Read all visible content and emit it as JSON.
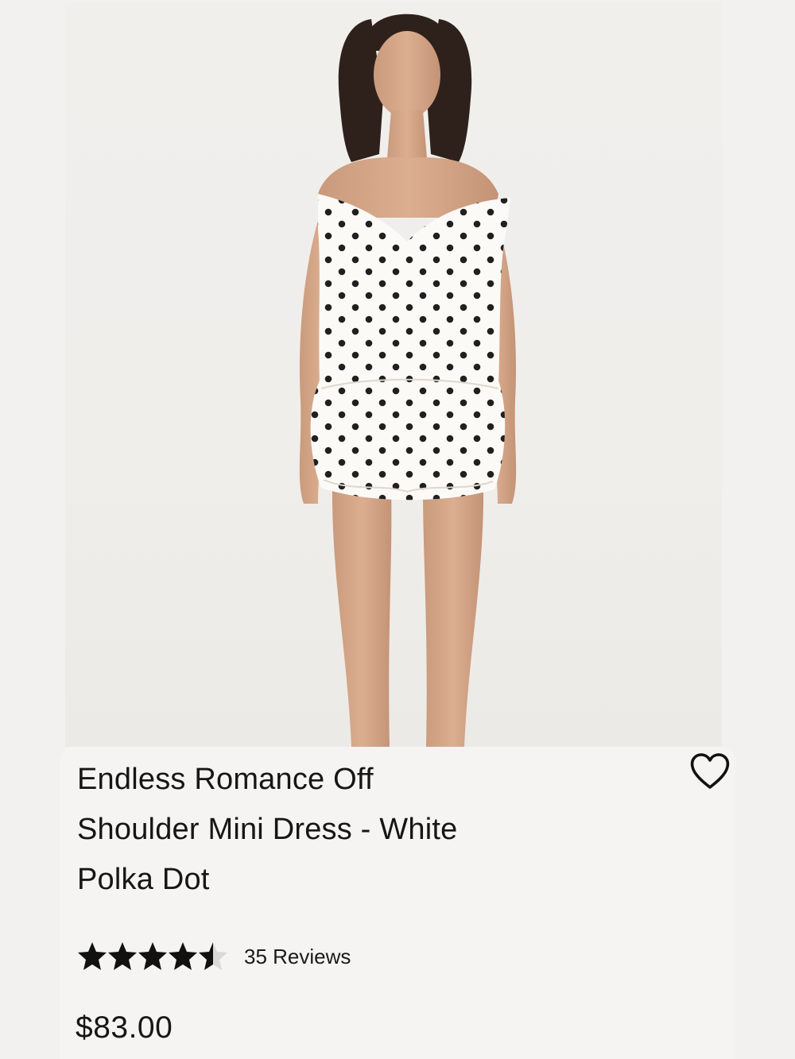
{
  "product": {
    "image_alt": "Model wearing white off shoulder mini dress with black polka dots",
    "title_lines": [
      "Endless Romance Off",
      "Shoulder Mini Dress - White",
      "Polka Dot"
    ],
    "rating": 4.5,
    "rating_max": 5,
    "reviews_label": "35 Reviews",
    "price": "$83.00",
    "wishlist_icon": "heart-outline-icon"
  }
}
